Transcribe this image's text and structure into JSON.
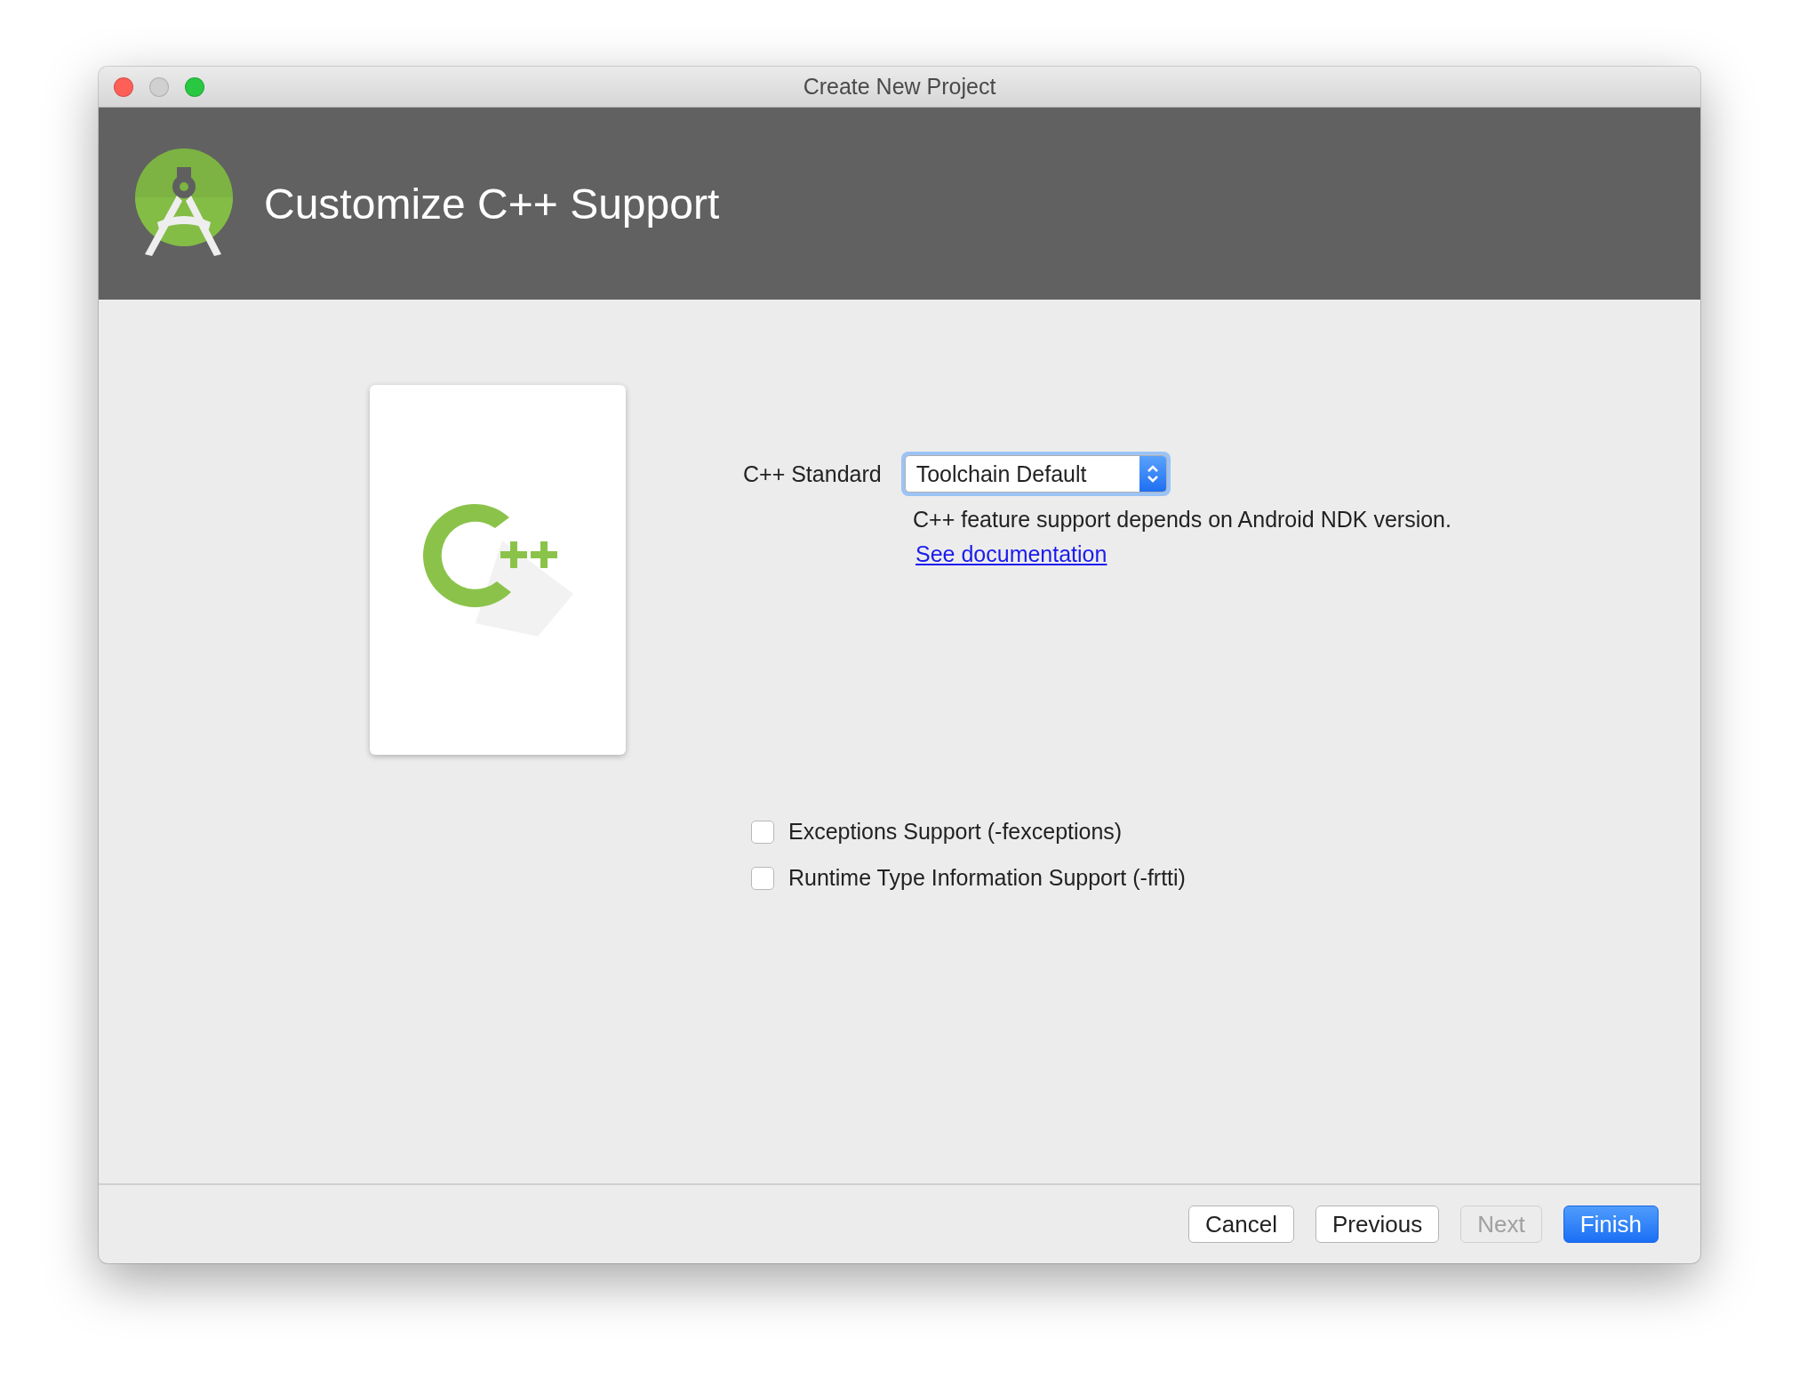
{
  "window": {
    "title": "Create New Project"
  },
  "header": {
    "title": "Customize C++ Support"
  },
  "cpp_standard": {
    "label": "C++ Standard",
    "value": "Toolchain Default",
    "focused": true
  },
  "note": "C++ feature support depends on Android NDK version.",
  "link": "See documentation",
  "checkboxes": [
    {
      "label": "Exceptions Support (-fexceptions)",
      "checked": false
    },
    {
      "label": "Runtime Type Information Support (-frtti)",
      "checked": false
    }
  ],
  "buttons": [
    {
      "label": "Cancel",
      "kind": "normal",
      "disabled": false
    },
    {
      "label": "Previous",
      "kind": "normal",
      "disabled": false
    },
    {
      "label": "Next",
      "kind": "normal",
      "disabled": true
    },
    {
      "label": "Finish",
      "kind": "default",
      "disabled": false
    }
  ]
}
